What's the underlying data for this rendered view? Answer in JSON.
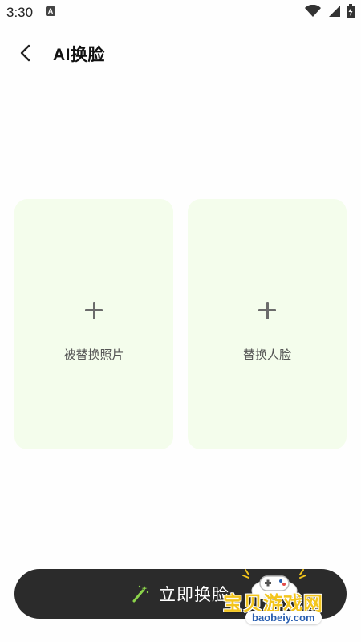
{
  "status": {
    "time": "3:30",
    "notification_icon": "android-app-icon",
    "icons": [
      "wifi-icon",
      "signal-icon",
      "battery-icon"
    ]
  },
  "header": {
    "back_icon": "back-arrow-icon",
    "title": "AI换脸"
  },
  "cards": [
    {
      "label": "被替换照片",
      "icon": "plus-icon"
    },
    {
      "label": "替换人脸",
      "icon": "plus-icon"
    }
  ],
  "action": {
    "label": "立即换脸",
    "icon": "magic-wand-icon"
  },
  "watermark": {
    "text": "宝贝游戏网",
    "url": "baobeiy.com"
  },
  "colors": {
    "card_bg": "#f4fdec",
    "button_bg": "#2b2b2b",
    "wand_green": "#8bd34a",
    "watermark_yellow": "#f3c51d"
  }
}
